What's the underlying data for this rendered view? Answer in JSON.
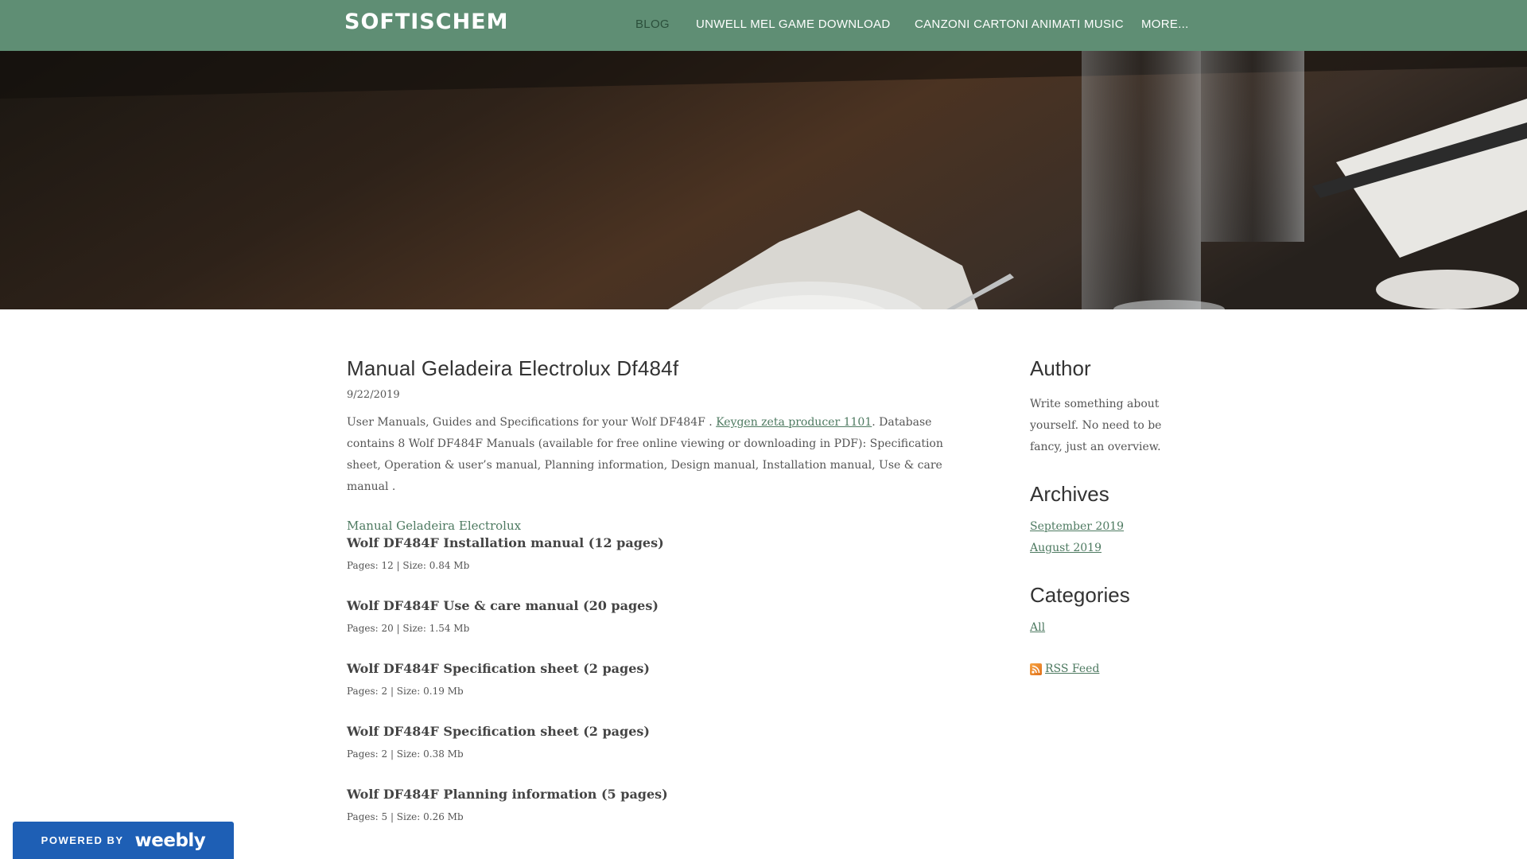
{
  "site": {
    "title": "SOFTISCHEM"
  },
  "nav": [
    {
      "label": "BLOG",
      "active": true
    },
    {
      "label": "UNWELL MEL GAME DOWNLOAD",
      "active": false
    },
    {
      "label": "CANZONI CARTONI ANIMATI MUSIC",
      "active": false
    },
    {
      "label": "MORE...",
      "active": false
    }
  ],
  "post": {
    "title": "Manual Geladeira Electrolux Df484f",
    "date": "9/22/2019",
    "intro_before": "User Manuals, Guides and Specifications for your Wolf DF484F . ",
    "intro_link": "Keygen zeta producer 1101",
    "intro_after": ". Database contains 8 Wolf DF484F Manuals (available for free online viewing or downloading in PDF): Specification sheet, Operation & user’s manual, Planning information, Design manual, Installation manual, Use & care manual .",
    "section_link": "Manual Geladeira Electrolux",
    "manuals": [
      {
        "title": "Wolf DF484F Installation manual (12 pages)",
        "meta": "Pages: 12 | Size: 0.84 Mb"
      },
      {
        "title": "Wolf DF484F Use & care manual (20 pages)",
        "meta": "Pages: 20 | Size: 1.54 Mb"
      },
      {
        "title": "Wolf DF484F Specification sheet (2 pages)",
        "meta": "Pages: 2 | Size: 0.19 Mb"
      },
      {
        "title": "Wolf DF484F Specification sheet (2 pages)",
        "meta": "Pages: 2 | Size: 0.38 Mb"
      },
      {
        "title": "Wolf DF484F Planning information (5 pages)",
        "meta": "Pages: 5 | Size: 0.26 Mb"
      }
    ]
  },
  "sidebar": {
    "author": {
      "heading": "Author",
      "text": "Write something about yourself. No need to be fancy, just an overview."
    },
    "archives": {
      "heading": "Archives",
      "items": [
        "September 2019",
        "August 2019"
      ]
    },
    "categories": {
      "heading": "Categories",
      "items": [
        "All"
      ]
    },
    "rss": {
      "label": "RSS Feed",
      "icon": "rss-icon"
    }
  },
  "badge": {
    "prefix": "POWERED BY",
    "brand": "weebly"
  },
  "colors": {
    "header_bg": "#5f8e74",
    "link": "#4e7a61",
    "badge_bg": "#1e5fb5"
  }
}
